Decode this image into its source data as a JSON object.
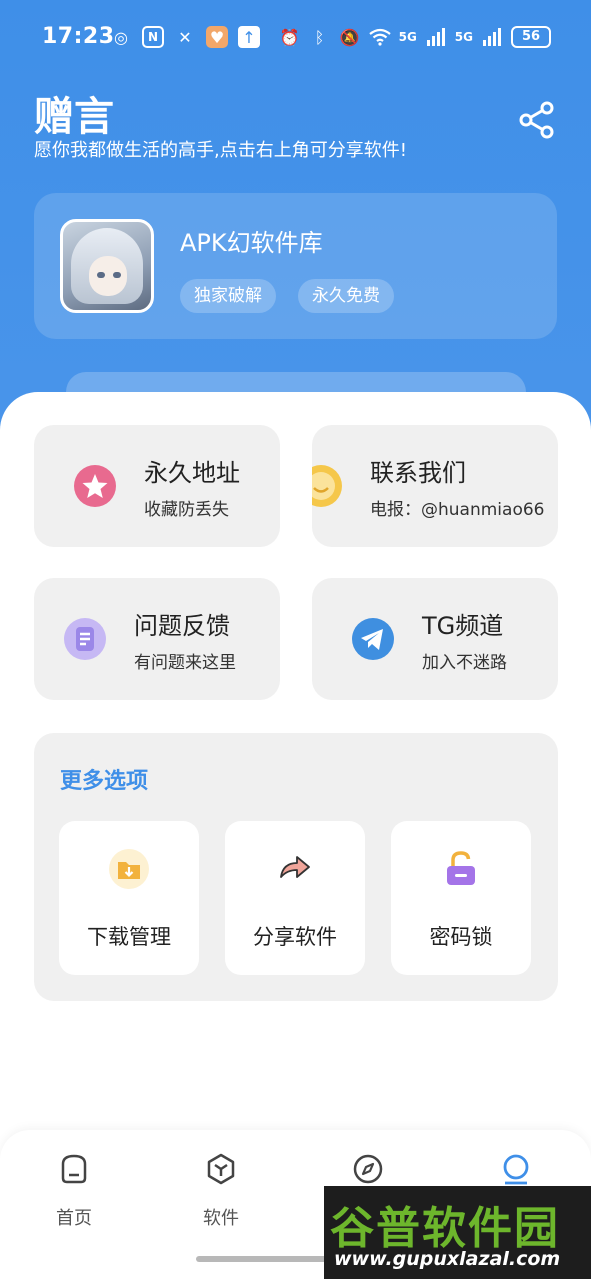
{
  "status_bar": {
    "time": "17:23",
    "battery": "56",
    "signal_1": "5G",
    "signal_2": "5G"
  },
  "header": {
    "title": "赠言",
    "subtitle": "愿你我都做生活的高手,点击右上角可分享软件!",
    "share_icon": "share-icon"
  },
  "profile": {
    "name": "APK幻软件库",
    "tags": [
      "独家破解",
      "永久免费"
    ]
  },
  "quick_cards": [
    {
      "title": "永久地址",
      "subtitle": "收藏防丢失",
      "icon": "star-icon",
      "color": "#e86a8f"
    },
    {
      "title": "联系我们",
      "subtitle": "电报：@huanmiao66",
      "icon": "smile-icon",
      "color": "#f5c74a"
    },
    {
      "title": "问题反馈",
      "subtitle": "有问题来这里",
      "icon": "note-icon",
      "color": "#9b87e8"
    },
    {
      "title": "TG频道",
      "subtitle": "加入不迷路",
      "icon": "telegram-icon",
      "color": "#3f8fe0"
    }
  ],
  "more_options": {
    "title": "更多选项",
    "items": [
      {
        "label": "下载管理",
        "icon": "download-folder-icon",
        "color": "#f2b23d"
      },
      {
        "label": "分享软件",
        "icon": "share-arrow-icon",
        "color": "#f0a59a"
      },
      {
        "label": "密码锁",
        "icon": "lock-icon",
        "color": "#a474e8"
      }
    ]
  },
  "bottom_nav": [
    {
      "label": "首页",
      "icon": "home-icon"
    },
    {
      "label": "软件",
      "icon": "cube-icon"
    },
    {
      "label": "",
      "icon": "compass-icon"
    },
    {
      "label": "",
      "icon": "profile-icon"
    }
  ],
  "watermark": {
    "brand": "谷普软件园",
    "url": "www.gupuxlazal.com"
  },
  "colors": {
    "accent": "#3f8fe8",
    "card_bg": "#f0f0f0"
  }
}
